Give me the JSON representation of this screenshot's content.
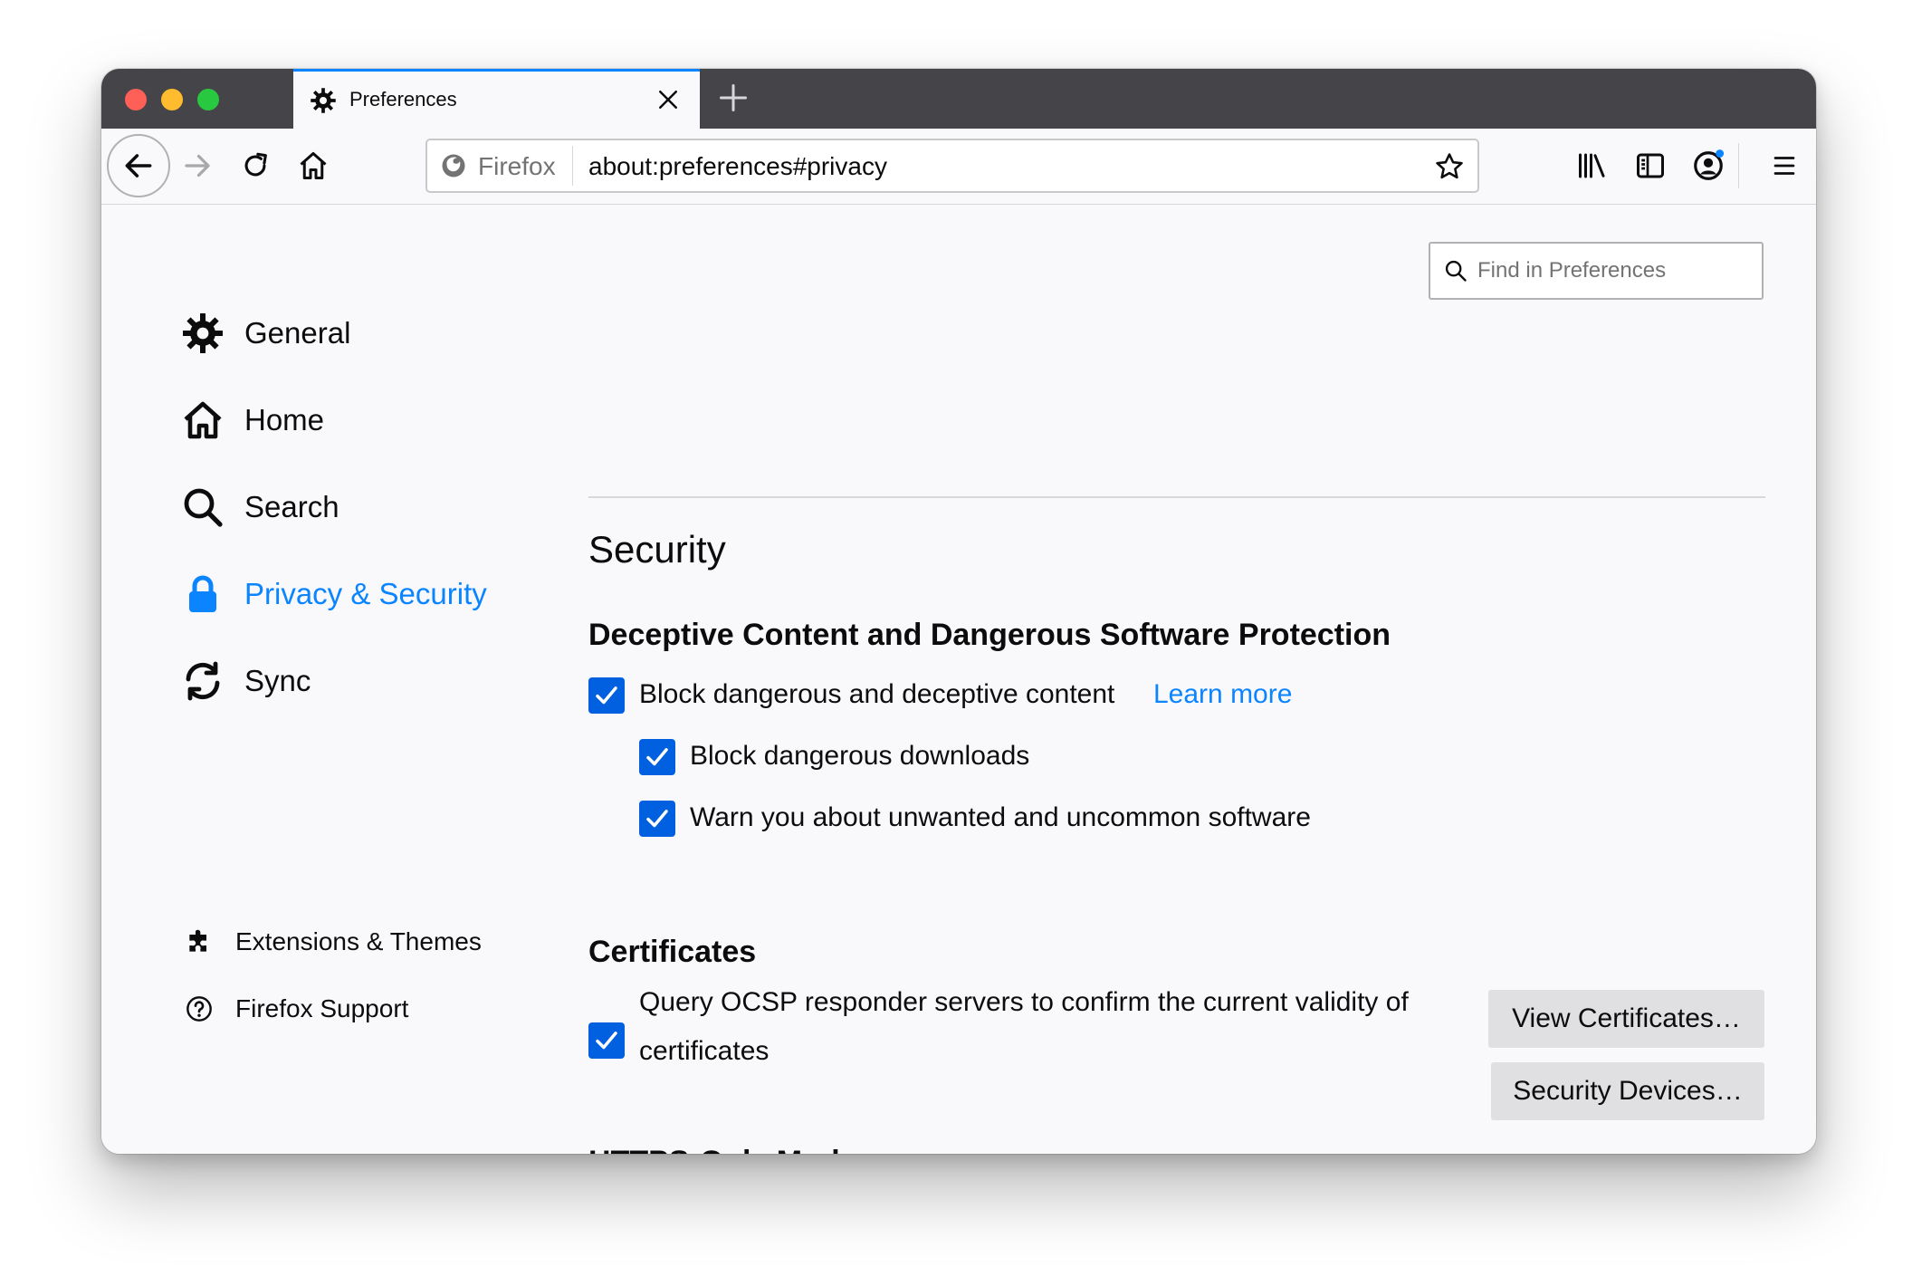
{
  "window": {
    "tab_title": "Preferences",
    "colors": {
      "accent": "#0a84ff",
      "checkbox": "#0060df",
      "tabbar": "#454549"
    }
  },
  "navbar": {
    "identity_label": "Firefox",
    "url": "about:preferences#privacy",
    "icons": [
      "back-arrow-icon",
      "forward-arrow-icon",
      "reload-icon",
      "home-icon",
      "bookmark-star-icon",
      "library-icon",
      "sidebar-icon",
      "account-icon",
      "hamburger-menu-icon"
    ]
  },
  "search": {
    "placeholder": "Find in Preferences"
  },
  "sidebar": {
    "categories": [
      {
        "label": "General",
        "icon": "gear-icon",
        "selected": false
      },
      {
        "label": "Home",
        "icon": "home-icon",
        "selected": false
      },
      {
        "label": "Search",
        "icon": "search-icon",
        "selected": false
      },
      {
        "label": "Privacy & Security",
        "icon": "lock-icon",
        "selected": true
      },
      {
        "label": "Sync",
        "icon": "sync-icon",
        "selected": false
      }
    ],
    "footer": [
      {
        "label": "Extensions & Themes",
        "icon": "puzzle-icon"
      },
      {
        "label": "Firefox Support",
        "icon": "help-icon"
      }
    ]
  },
  "main": {
    "section_title": "Security",
    "deceptive": {
      "heading": "Deceptive Content and Dangerous Software Protection",
      "block_content": {
        "label": "Block dangerous and deceptive content",
        "checked": true
      },
      "learn_more": "Learn more",
      "block_downloads": {
        "label": "Block dangerous downloads",
        "checked": true
      },
      "warn_unwanted": {
        "label": "Warn you about unwanted and uncommon software",
        "checked": true
      }
    },
    "certificates": {
      "heading": "Certificates",
      "ocsp": {
        "label": "Query OCSP responder servers to confirm the current validity of certificates",
        "checked": true
      },
      "view_button": "View Certificates…",
      "devices_button": "Security Devices…"
    },
    "next_heading": "HTTPS-Only Mode"
  }
}
